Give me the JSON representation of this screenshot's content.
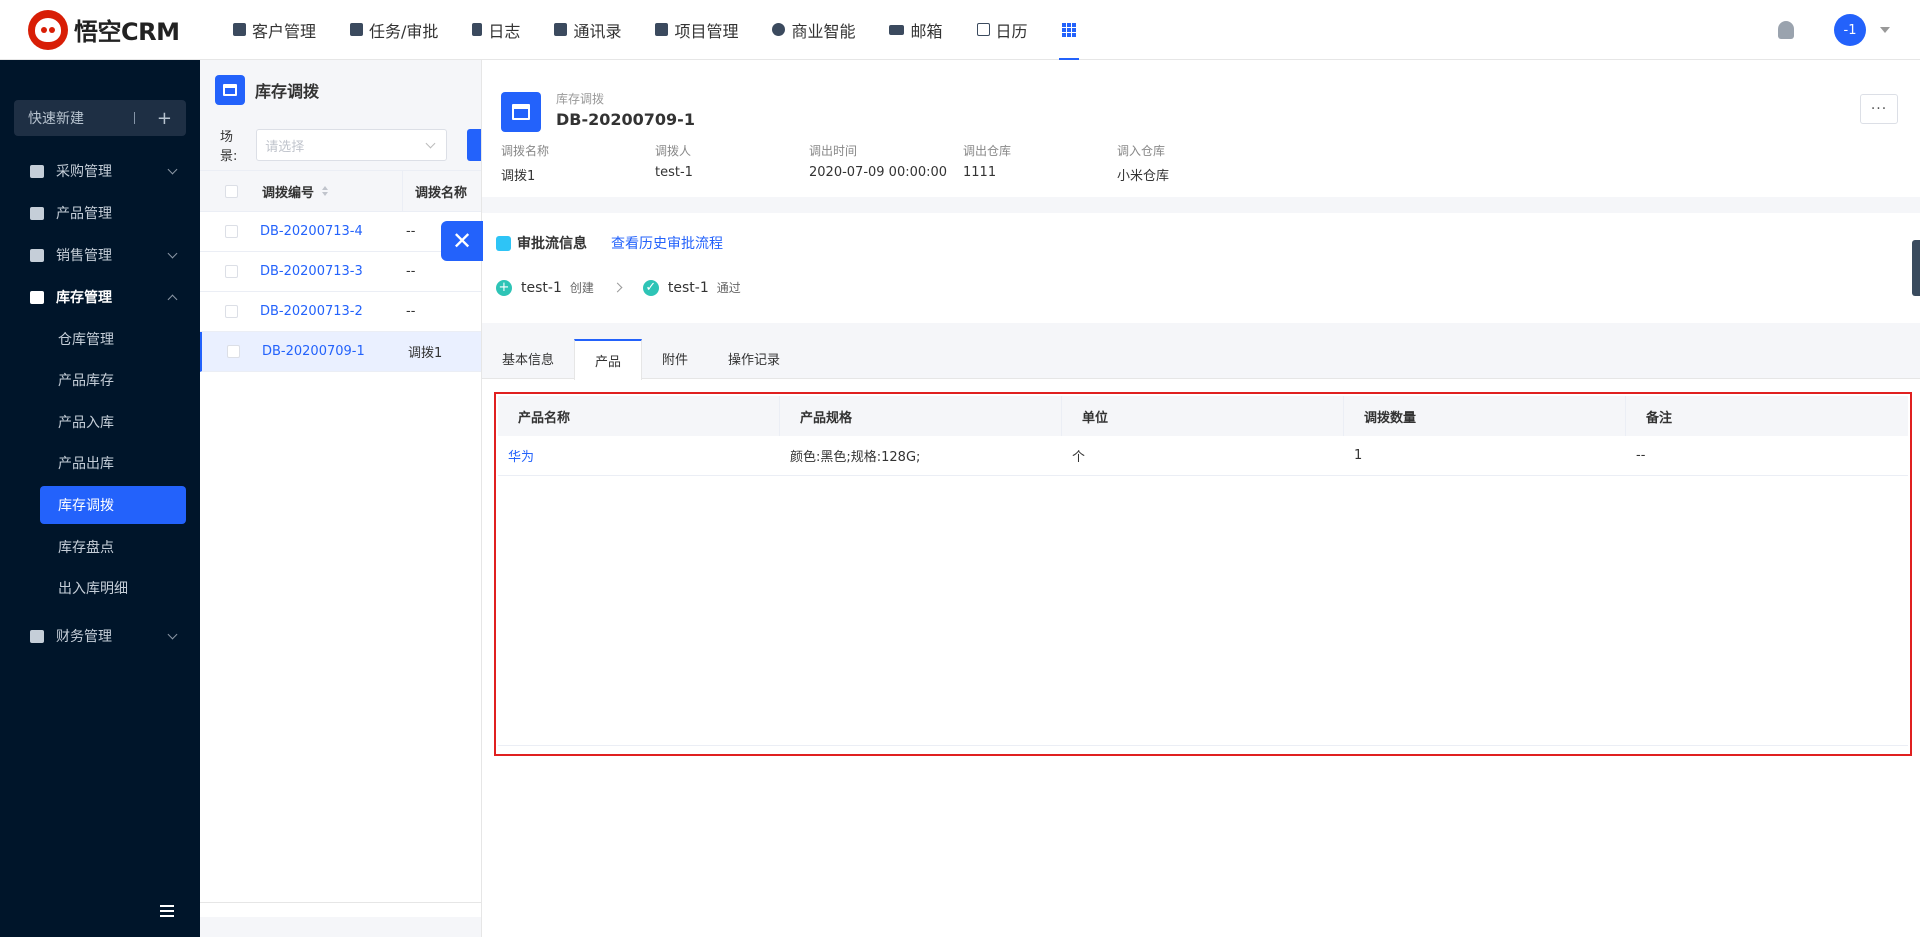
{
  "app": {
    "logo_text": "悟空CRM"
  },
  "nav": {
    "items": [
      {
        "label": "客户管理",
        "icon": "building-icon"
      },
      {
        "label": "任务/审批",
        "icon": "briefcase-icon"
      },
      {
        "label": "日志",
        "icon": "book-icon"
      },
      {
        "label": "通讯录",
        "icon": "phone-book-icon"
      },
      {
        "label": "项目管理",
        "icon": "project-icon"
      },
      {
        "label": "商业智能",
        "icon": "shield-check-icon"
      },
      {
        "label": "邮箱",
        "icon": "envelope-icon"
      },
      {
        "label": "日历",
        "icon": "calendar-icon"
      }
    ],
    "apps_icon": "apps-grid-icon",
    "user_avatar": "-1"
  },
  "sidebar": {
    "quick_new": "快速新建",
    "quick_plus": "+",
    "menus": [
      {
        "label": "采购管理"
      },
      {
        "label": "产品管理"
      },
      {
        "label": "销售管理"
      },
      {
        "label": "库存管理"
      }
    ],
    "submenus": [
      "仓库管理",
      "产品库存",
      "产品入库",
      "产品出库",
      "库存调拨",
      "库存盘点",
      "出入库明细"
    ],
    "finance": "财务管理"
  },
  "list": {
    "title": "库存调拨",
    "scene_label": "场景:",
    "scene_placeholder": "请选择",
    "columns": [
      "调拨编号",
      "调拨名称"
    ],
    "rows": [
      {
        "no": "DB-20200713-4",
        "name": "--"
      },
      {
        "no": "DB-20200713-3",
        "name": "--"
      },
      {
        "no": "DB-20200713-2",
        "name": "--"
      },
      {
        "no": "DB-20200709-1",
        "name": "调拨1"
      }
    ]
  },
  "detail": {
    "type": "库存调拨",
    "number": "DB-20200709-1",
    "more": "···",
    "fields": [
      {
        "label": "调拨名称",
        "value": "调拨1"
      },
      {
        "label": "调拨人",
        "value": "test-1"
      },
      {
        "label": "调出时间",
        "value": "2020-07-09 00:00:00"
      },
      {
        "label": "调出仓库",
        "value": "1111"
      },
      {
        "label": "调入仓库",
        "value": "小米仓库"
      }
    ],
    "approval": {
      "title": "审批流信息",
      "history_link": "查看历史审批流程",
      "steps": [
        {
          "user": "test-1",
          "action": "创建",
          "symbol": "+"
        },
        {
          "user": "test-1",
          "action": "通过",
          "symbol": "✓"
        }
      ]
    },
    "tabs": [
      "基本信息",
      "产品",
      "附件",
      "操作记录"
    ],
    "active_tab": "产品",
    "products": {
      "columns": [
        "产品名称",
        "产品规格",
        "单位",
        "调拨数量",
        "备注"
      ],
      "rows": [
        [
          "华为",
          "颜色:黑色;规格:128G;",
          "个",
          "1",
          "--"
        ]
      ]
    }
  },
  "colors": {
    "accent": "#2362fb",
    "sidebar_bg": "#00152a",
    "highlight_border": "#e02020"
  }
}
